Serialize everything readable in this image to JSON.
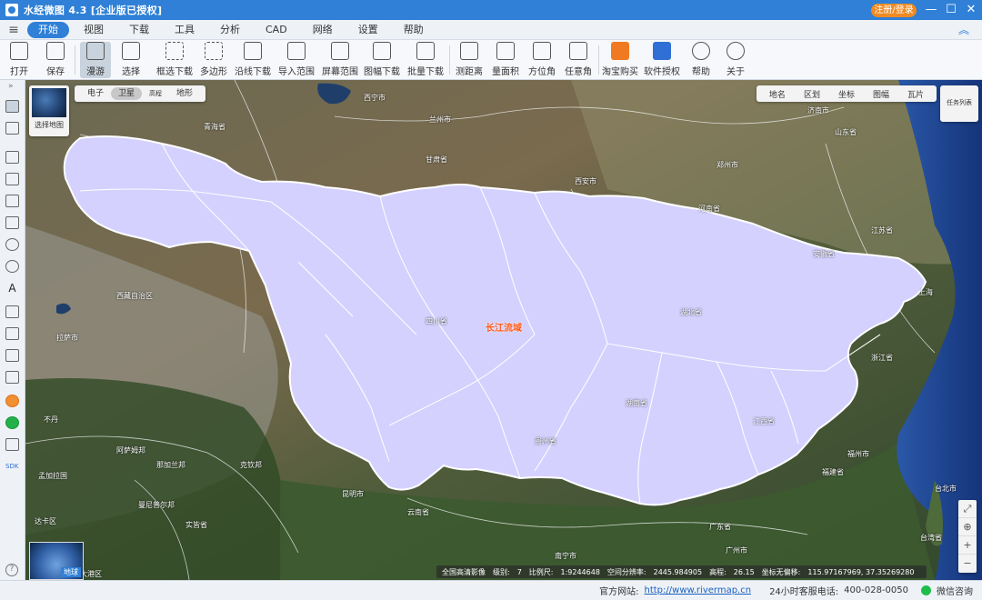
{
  "titlebar": {
    "title": "水经微图 4.3 [企业版已授权]",
    "login_label": "注册/登录",
    "minimize": "—",
    "maximize": "☐",
    "close": "✕"
  },
  "menu": {
    "items": [
      "开始",
      "视图",
      "下载",
      "工具",
      "分析",
      "CAD",
      "网络",
      "设置",
      "帮助"
    ],
    "active_index": 0
  },
  "toolbar": {
    "items": [
      {
        "label": "打开",
        "icon": "folder-icon"
      },
      {
        "label": "保存",
        "icon": "save-icon"
      },
      {
        "label": "漫游",
        "icon": "hand-icon"
      },
      {
        "label": "选择",
        "icon": "cursor-icon"
      },
      {
        "label": "框选下载",
        "icon": "box-select-icon"
      },
      {
        "label": "多边形",
        "icon": "polygon-icon"
      },
      {
        "label": "沿线下载",
        "icon": "polyline-icon"
      },
      {
        "label": "导入范围",
        "icon": "import-icon"
      },
      {
        "label": "屏幕范围",
        "icon": "screen-icon"
      },
      {
        "label": "图幅下载",
        "icon": "grid-icon"
      },
      {
        "label": "批量下载",
        "icon": "batch-icon"
      },
      {
        "label": "测距离",
        "icon": "ruler-icon"
      },
      {
        "label": "量面积",
        "icon": "area-icon"
      },
      {
        "label": "方位角",
        "icon": "azimuth-icon"
      },
      {
        "label": "任意角",
        "icon": "angle-icon"
      },
      {
        "label": "淘宝购买",
        "icon": "taobao-icon"
      },
      {
        "label": "软件授权",
        "icon": "license-icon"
      },
      {
        "label": "帮助",
        "icon": "help-icon"
      },
      {
        "label": "关于",
        "icon": "about-icon"
      }
    ],
    "active_tool": "漫游"
  },
  "map": {
    "basemap_switch_label": "选择地图",
    "map_types": [
      "电子",
      "卫星",
      "高程",
      "地形"
    ],
    "active_map_type": "卫星",
    "overlays": [
      "地名",
      "区划",
      "坐标",
      "图幅",
      "瓦片"
    ],
    "task_list_label": "任务列表",
    "globe_label": "地球",
    "basin_label": "长江流域",
    "place_labels": [
      "西宁市",
      "青海省",
      "兰州市",
      "西安市",
      "河南省",
      "郑州市",
      "济南市",
      "山东省",
      "甘肃省",
      "四川省",
      "安徽省",
      "江苏省",
      "上海",
      "浙江省",
      "湖北省",
      "湖南省",
      "江西省",
      "福建省",
      "福州市",
      "广东省",
      "广州市",
      "南宁市",
      "贵州省",
      "云南省",
      "昆明市",
      "拉萨市",
      "不丹",
      "孟加拉国",
      "阿萨姆邦",
      "那加兰邦",
      "曼尼普尔邦",
      "实皆省",
      "克钦邦",
      "台北市",
      "台湾省",
      "西藏自治区",
      "达卡区",
      "吉大港区"
    ]
  },
  "status": {
    "imagery": "全国高清影像",
    "level_label": "级别:",
    "level": "7",
    "scale_label": "比例尺:",
    "scale": "1:9244648",
    "resolution_label": "空间分辨率:",
    "resolution": "2445.984905",
    "elevation_label": "高程:",
    "elevation": "26.15",
    "coord_label": "坐标无偏移:",
    "coords": "115.97167969, 37.35269280"
  },
  "footer": {
    "site_label": "官方网站:",
    "site_url": "http://www.rivermap.cn",
    "hotline_label": "24小时客服电话:",
    "hotline": "400-028-0050",
    "wechat": "微信咨询"
  },
  "colors": {
    "titlebar": "#2f80d6",
    "login": "#f08a24",
    "basin_fill": "#d4d1ff",
    "basin_label": "#ff5a1a",
    "ocean": "#1c3f8a"
  }
}
